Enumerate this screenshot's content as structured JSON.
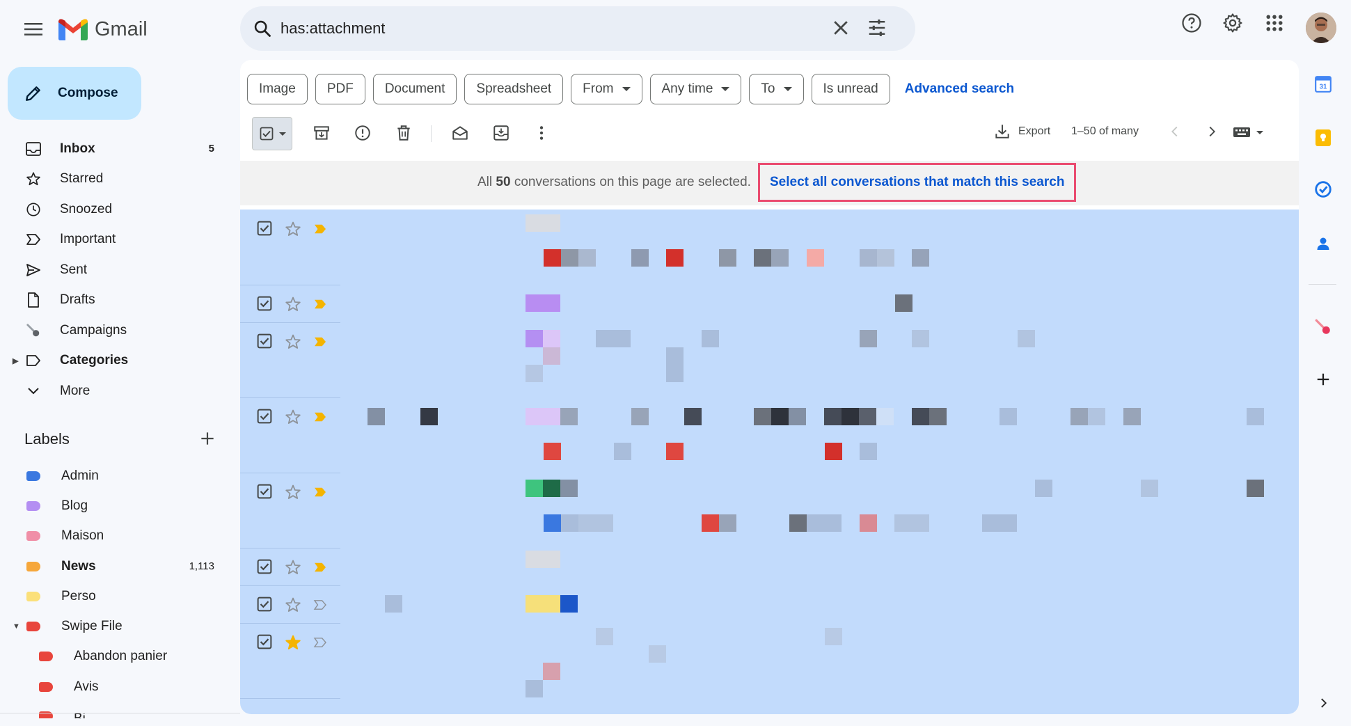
{
  "app": {
    "name": "Gmail"
  },
  "search": {
    "query": "has:attachment"
  },
  "compose": {
    "label": "Compose"
  },
  "nav": [
    {
      "name": "inbox",
      "label": "Inbox",
      "count": "5",
      "bold": true
    },
    {
      "name": "starred",
      "label": "Starred"
    },
    {
      "name": "snoozed",
      "label": "Snoozed"
    },
    {
      "name": "important",
      "label": "Important"
    },
    {
      "name": "sent",
      "label": "Sent"
    },
    {
      "name": "drafts",
      "label": "Drafts"
    },
    {
      "name": "campaigns",
      "label": "Campaigns"
    },
    {
      "name": "categories",
      "label": "Categories",
      "bold": true
    },
    {
      "name": "more",
      "label": "More"
    }
  ],
  "labels_section": {
    "title": "Labels"
  },
  "labels": [
    {
      "label": "Admin",
      "color": "#3a78e0"
    },
    {
      "label": "Blog",
      "color": "#b48ff2"
    },
    {
      "label": "Maison",
      "color": "#f08fa7"
    },
    {
      "label": "News",
      "color": "#f6a73b",
      "count": "1,113",
      "bold": true
    },
    {
      "label": "Perso",
      "color": "#fbe07a"
    },
    {
      "label": "Swipe File",
      "color": "#e8453c"
    },
    {
      "label": "Abandon panier",
      "color": "#e8453c",
      "sub": true
    },
    {
      "label": "Avis",
      "color": "#e8453c",
      "sub": true
    },
    {
      "label": "Bi...",
      "color": "#e8453c",
      "sub": true
    }
  ],
  "filters": {
    "chips": [
      {
        "label": "Image",
        "dropdown": false
      },
      {
        "label": "PDF",
        "dropdown": false
      },
      {
        "label": "Document",
        "dropdown": false
      },
      {
        "label": "Spreadsheet",
        "dropdown": false
      },
      {
        "label": "From",
        "dropdown": true
      },
      {
        "label": "Any time",
        "dropdown": true
      },
      {
        "label": "To",
        "dropdown": true
      },
      {
        "label": "Is unread",
        "dropdown": false
      }
    ],
    "advanced": "Advanced search"
  },
  "toolbar": {
    "export_label": "Export",
    "paging": "1–50 of many"
  },
  "banner": {
    "prefix": "All ",
    "count": "50",
    "suffix": " conversations on this page are selected.",
    "link": "Select all conversations that match this search"
  },
  "colors": {
    "accent": "#0b57d0",
    "selected_row": "#c2dbfc",
    "highlight_border": "#ea4c70",
    "compose_bg": "#c2e7ff"
  },
  "rows": [
    {
      "starred": false,
      "important": true
    },
    {
      "starred": false,
      "important": true
    },
    {
      "starred": false,
      "important": true
    },
    {
      "starred": false,
      "important": true
    },
    {
      "starred": false,
      "important": true
    },
    {
      "starred": false,
      "important": true
    },
    {
      "starred": false,
      "important": false
    },
    {
      "starred": true,
      "important": false
    }
  ]
}
